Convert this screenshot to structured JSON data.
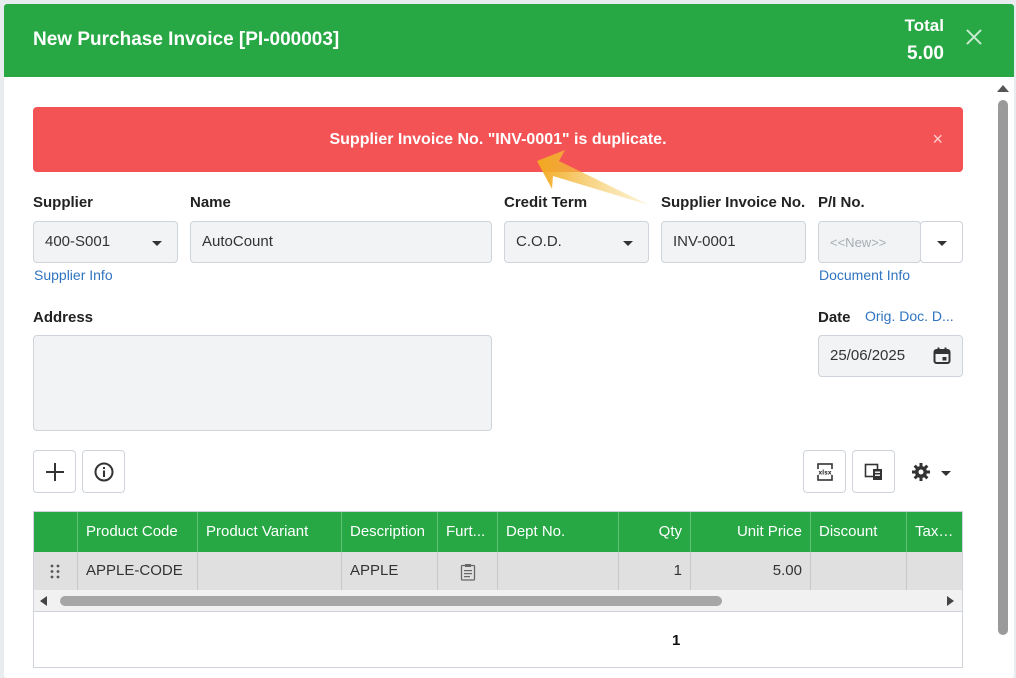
{
  "header": {
    "title": "New Purchase Invoice [PI-000003]",
    "total_label": "Total",
    "total_value": "5.00"
  },
  "alert": {
    "message": "Supplier Invoice No. \"INV-0001\" is duplicate.",
    "close": "×"
  },
  "form": {
    "supplier_label": "Supplier",
    "supplier_value": "400-S001",
    "supplier_info_link": "Supplier Info",
    "name_label": "Name",
    "name_value": "AutoCount",
    "credit_term_label": "Credit Term",
    "credit_term_value": "C.O.D.",
    "supplier_invoice_label": "Supplier Invoice No.",
    "supplier_invoice_value": "INV-0001",
    "pi_no_label": "P/I No.",
    "pi_no_placeholder": "<<New>>",
    "document_info_link": "Document Info",
    "address_label": "Address",
    "address_value": "",
    "date_label": "Date",
    "orig_doc_link": "Orig. Doc. D...",
    "date_value": "25/06/2025"
  },
  "toolbar": {
    "add_icon": "plus-icon",
    "info_icon": "info-icon",
    "xlsx_icon": "xlsx-icon",
    "copy_icon": "copy-icon",
    "settings_icon": "gear-icon"
  },
  "grid": {
    "columns": [
      "",
      "Product Code",
      "Product Variant",
      "Description",
      "Furt...",
      "Dept No.",
      "Qty",
      "Unit Price",
      "Discount",
      "Tax Co"
    ],
    "rows": [
      {
        "product_code": "APPLE-CODE",
        "product_variant": "",
        "description": "APPLE",
        "further": "",
        "dept_no": "",
        "qty": "1",
        "unit_price": "5.00",
        "discount": "",
        "tax_code": ""
      }
    ],
    "footer_qty": "1"
  },
  "colors": {
    "header_green": "#27a844",
    "alert_red": "#f45355",
    "link_blue": "#2f74c0"
  }
}
